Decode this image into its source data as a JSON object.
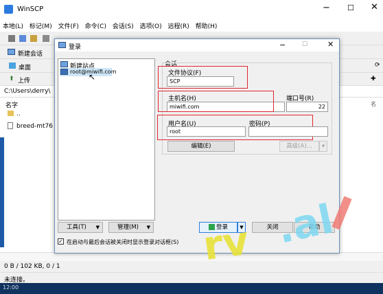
{
  "window": {
    "title": "WinSCP",
    "menu": [
      "本地(L)",
      "标记(M)",
      "文件(F)",
      "命令(C)",
      "会话(S)",
      "选项(O)",
      "远程(R)",
      "帮助(H)"
    ],
    "new_session_tab": "新建会话",
    "local_drive": "桌面",
    "upload_label": "上传",
    "path": "C:\\Users\\derry\\",
    "column_name": "名字",
    "files": [
      "..",
      "breed-mt76"
    ],
    "status_left": "0 B / 102 KB,  0 / 1",
    "status_conn": "未连接。",
    "taskbar_time": "12:00"
  },
  "dialog": {
    "title": "登录",
    "tree_items": [
      "新建站点",
      "root@miwifi.com"
    ],
    "group_label": "会话",
    "protocol_label": "文件协议(F)",
    "protocol_value": "SCP",
    "host_label": "主机名(H)",
    "host_value": "miwifi.com",
    "port_label": "端口号(R)",
    "port_value": "22",
    "user_label": "用户名(U)",
    "user_value": "root",
    "pass_label": "密码(P)",
    "pass_value": "",
    "edit_button": "编辑(E)",
    "advanced_button": "高级(A)...",
    "tools_button": "工具(T)",
    "manage_button": "管理(M)",
    "login_button": "登录",
    "close_button": "关闭",
    "help_button": "帮助",
    "checkbox_label": "在启动与最后会话被关闭时显示登录对话框(S)",
    "checkbox_checked": true
  },
  "watermark": {
    "text1": "rv",
    "text2": ".al"
  },
  "colors": {
    "desktop": "#1e5aa8",
    "red_highlight": "#e0262e",
    "login_green": "#2ea44f"
  }
}
